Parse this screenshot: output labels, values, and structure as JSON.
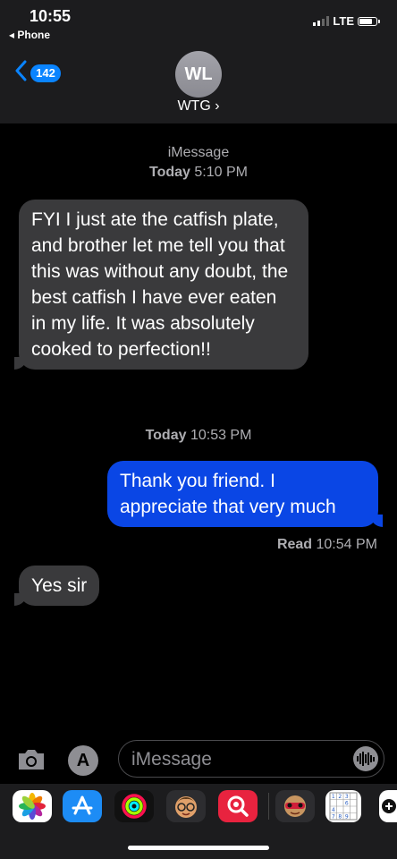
{
  "status": {
    "time": "10:55",
    "back_app": "◂ Phone",
    "network": "LTE"
  },
  "header": {
    "back_count": "142",
    "avatar_initials": "WL",
    "contact_name": "WTG ›"
  },
  "thread": {
    "service_label": "iMessage",
    "first_timestamp_day": "Today",
    "first_timestamp_time": " 5:10 PM",
    "messages": [
      {
        "text": "FYI I just ate the catfish plate, and brother let me tell you that this was without any doubt, the best catfish I have ever eaten in my life. It was absolutely cooked to perfection!!"
      },
      {
        "text": "Thank you friend.  I appreciate that very much"
      },
      {
        "text": "Yes sir"
      }
    ],
    "second_timestamp_day": "Today",
    "second_timestamp_time": " 10:53 PM",
    "read_label": "Read",
    "read_time": " 10:54 PM"
  },
  "composer": {
    "placeholder": "iMessage",
    "apps_glyph": "A"
  },
  "drawer": {
    "apps": [
      "photos-icon",
      "app-store-icon",
      "activity-icon",
      "memoji-icon",
      "web-search-icon",
      "animoji-icon",
      "sudoku-icon",
      "game-icon"
    ],
    "sudoku_digits": [
      "1",
      "2",
      "3",
      "",
      "",
      "",
      "6",
      "",
      "4",
      "",
      "",
      "",
      "7",
      "8",
      "9",
      ""
    ]
  }
}
